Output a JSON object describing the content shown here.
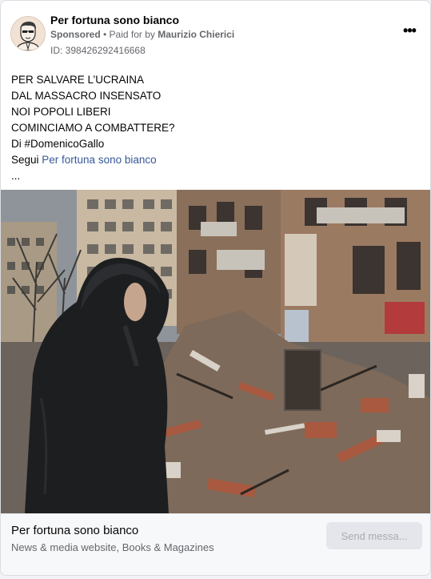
{
  "header": {
    "page_name": "Per fortuna sono bianco",
    "sponsored_label": "Sponsored",
    "separator": " • ",
    "paid_for_prefix": "Paid for by ",
    "payer": "Maurizio Chierici",
    "ad_id": "ID: 398426292416668",
    "more_icon": "more-horizontal-icon"
  },
  "post": {
    "lines": [
      "PER SALVARE L’UCRAINA",
      "DAL MASSACRO INSENSATO",
      "NOI POPOLI LIBERI",
      "COMINCIAMO A COMBATTERE?",
      "Di #DomenicoGallo"
    ],
    "follow_prefix": "Segui ",
    "follow_link": "Per fortuna sono bianco",
    "ellipsis": "..."
  },
  "footer": {
    "title": "Per fortuna sono bianco",
    "subtitle": "News & media website, Books & Magazines",
    "cta_label": "Send messa..."
  },
  "colors": {
    "link": "#385898",
    "muted": "#65676b",
    "cta_bg": "#e4e6eb",
    "cta_text": "#a8abaf"
  }
}
